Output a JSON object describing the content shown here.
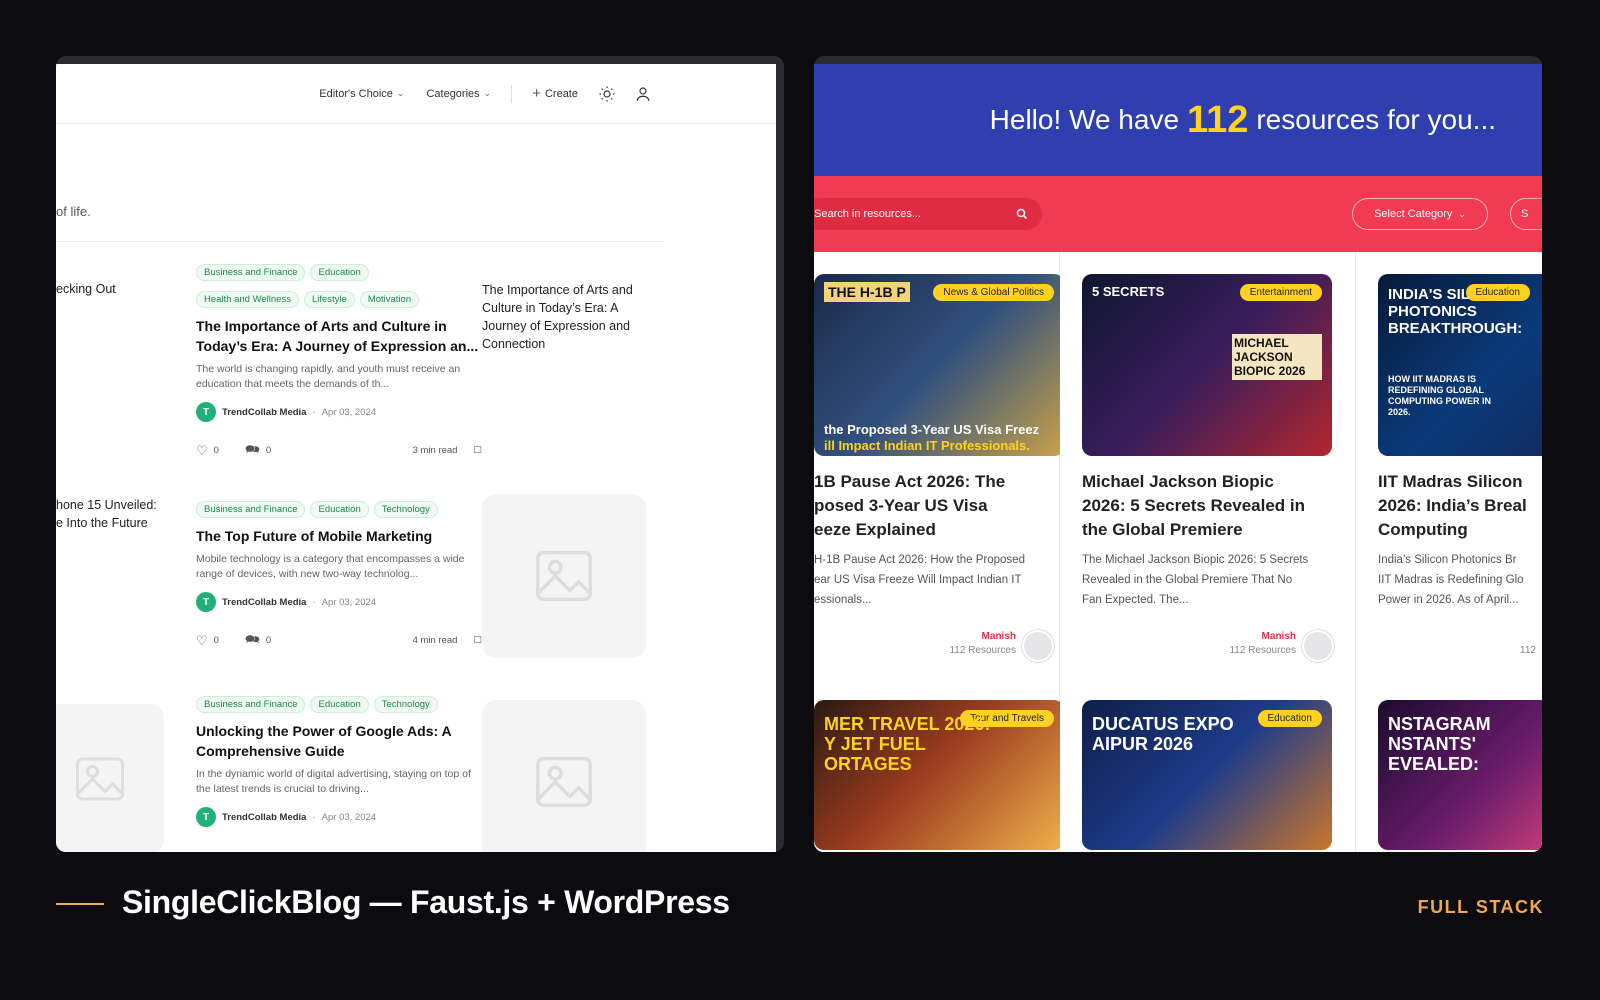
{
  "left": {
    "nav": {
      "editors_choice": "Editor's Choice",
      "categories": "Categories",
      "create": "Create"
    },
    "tagline": "of life.",
    "side_items": [
      "ecking Out",
      "hone 15 Unveiled:\ne Into the Future"
    ],
    "articles": [
      {
        "tags": [
          "Business and Finance",
          "Education",
          "Health and Wellness",
          "Lifestyle",
          "Motivation"
        ],
        "title": "The Importance of Arts and Culture in Today’s Era: A Journey of Expression an...",
        "excerpt": "The world is changing rapidly, and youth must receive an education that meets the demands of th...",
        "author": "TrendCollab Media",
        "avatar_letter": "T",
        "date": "Apr 03, 2024",
        "likes": "0",
        "comments": "0",
        "read": "3 min read",
        "image_alt": "The Importance of Arts and Culture in Today’s Era: A Journey of Expression and Connection"
      },
      {
        "tags": [
          "Business and Finance",
          "Education",
          "Technology"
        ],
        "title": "The Top Future of Mobile Marketing",
        "excerpt": "Mobile technology is a category that encompasses a wide range of devices, with new two-way technolog...",
        "author": "TrendCollab Media",
        "avatar_letter": "T",
        "date": "Apr 03, 2024",
        "likes": "0",
        "comments": "0",
        "read": "4 min read"
      },
      {
        "tags": [
          "Business and Finance",
          "Education",
          "Technology"
        ],
        "title": "Unlocking the Power of Google Ads: A Comprehensive Guide",
        "excerpt": "In the dynamic world of digital advertising, staying on top of the latest trends is crucial to driving...",
        "author": "TrendCollab Media",
        "avatar_letter": "T",
        "date": "Apr 03, 2024"
      }
    ]
  },
  "right": {
    "hero": {
      "before": "Hello! We have",
      "count": "112",
      "after": "resources for you..."
    },
    "search_placeholder": "Search in resources...",
    "select_category": "Select Category",
    "select2": "S",
    "cards": [
      {
        "badge": "News & Global Politics",
        "img_top": "THE H-1B P",
        "img_bottom": "the Proposed 3-Year US Visa Freez",
        "img_bottom2": "ill Impact Indian IT Professionals.",
        "title": "1B Pause Act 2026: The\nposed 3-Year US Visa\neeze Explained",
        "excerpt": "H-1B Pause Act 2026: How the Proposed\near US Visa Freeze Will Impact Indian IT\nessionals...",
        "author": "Manish",
        "resources": "112 Resources"
      },
      {
        "badge": "Entertainment",
        "img_top": "5 SECRETS",
        "img_bottom": "MICHAEL JACKSON BIOPIC 2026",
        "title": "Michael Jackson Biopic\n2026: 5 Secrets Revealed in\nthe Global Premiere",
        "excerpt": "The Michael Jackson Biopic 2026: 5 Secrets\nRevealed in the Global Premiere That No\nFan Expected. The...",
        "author": "Manish",
        "resources": "112 Resources"
      },
      {
        "badge": "Education",
        "img_top": "INDIA'S SILICON PHOTONICS BREAKTHROUGH:",
        "img_bottom": "HOW IIT MADRAS IS REDEFINING GLOBAL COMPUTING POWER IN 2026.",
        "title": "IIT Madras Silicon\n2026: India’s Breal\nComputing",
        "excerpt": "India’s Silicon Photonics Br\nIIT Madras is Redefining Glo\nPower in 2026. As of April...",
        "resources": "112"
      }
    ],
    "cards_row2": [
      {
        "badge": "Tour and Travels",
        "img_text": "MER TRAVEL 2026:\nY JET FUEL\nORTAGES"
      },
      {
        "badge": "Education",
        "img_text": "DUCATUS EXPO\nAIPUR 2026"
      },
      {
        "badge": "",
        "img_text": "NSTAGRAM\nNSTANTS'\nEVEALED:"
      }
    ]
  },
  "caption": {
    "title": "SingleClickBlog — Faust.js + WordPress",
    "category": "FULL STACK"
  }
}
